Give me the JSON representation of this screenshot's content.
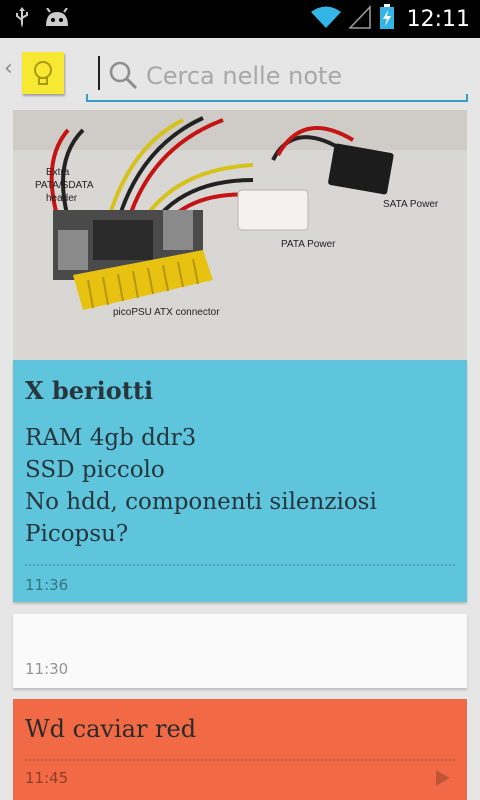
{
  "status_bar": {
    "time": "12:11",
    "icons": [
      "usb-icon",
      "android-icon",
      "wifi-icon",
      "signal-icon",
      "battery-charging-icon"
    ]
  },
  "action_bar": {
    "app_icon": "lightbulb-icon",
    "search_placeholder": "Cerca nelle note"
  },
  "image_labels": {
    "extra_header": [
      "Extra",
      "PATA/SDATA",
      "header"
    ],
    "pata_power": "PATA Power",
    "sata_power": "SATA Power",
    "atx_connector": "picoPSU ATX connector"
  },
  "notes": [
    {
      "color": "#5fc5dd",
      "title": "X beriotti",
      "lines": [
        "RAM 4gb ddr3",
        "SSD piccolo",
        "No hdd, componenti silenziosi",
        "Picopsu?"
      ],
      "time": "11:36"
    },
    {
      "color": "#fafafa",
      "title": "",
      "lines": [],
      "time": "11:30"
    },
    {
      "color": "#f26a45",
      "title": "Wd caviar red",
      "lines": [],
      "time": "11:45"
    }
  ],
  "colors": {
    "accent": "#33a0c8",
    "note_yellow": "#f7e933"
  }
}
